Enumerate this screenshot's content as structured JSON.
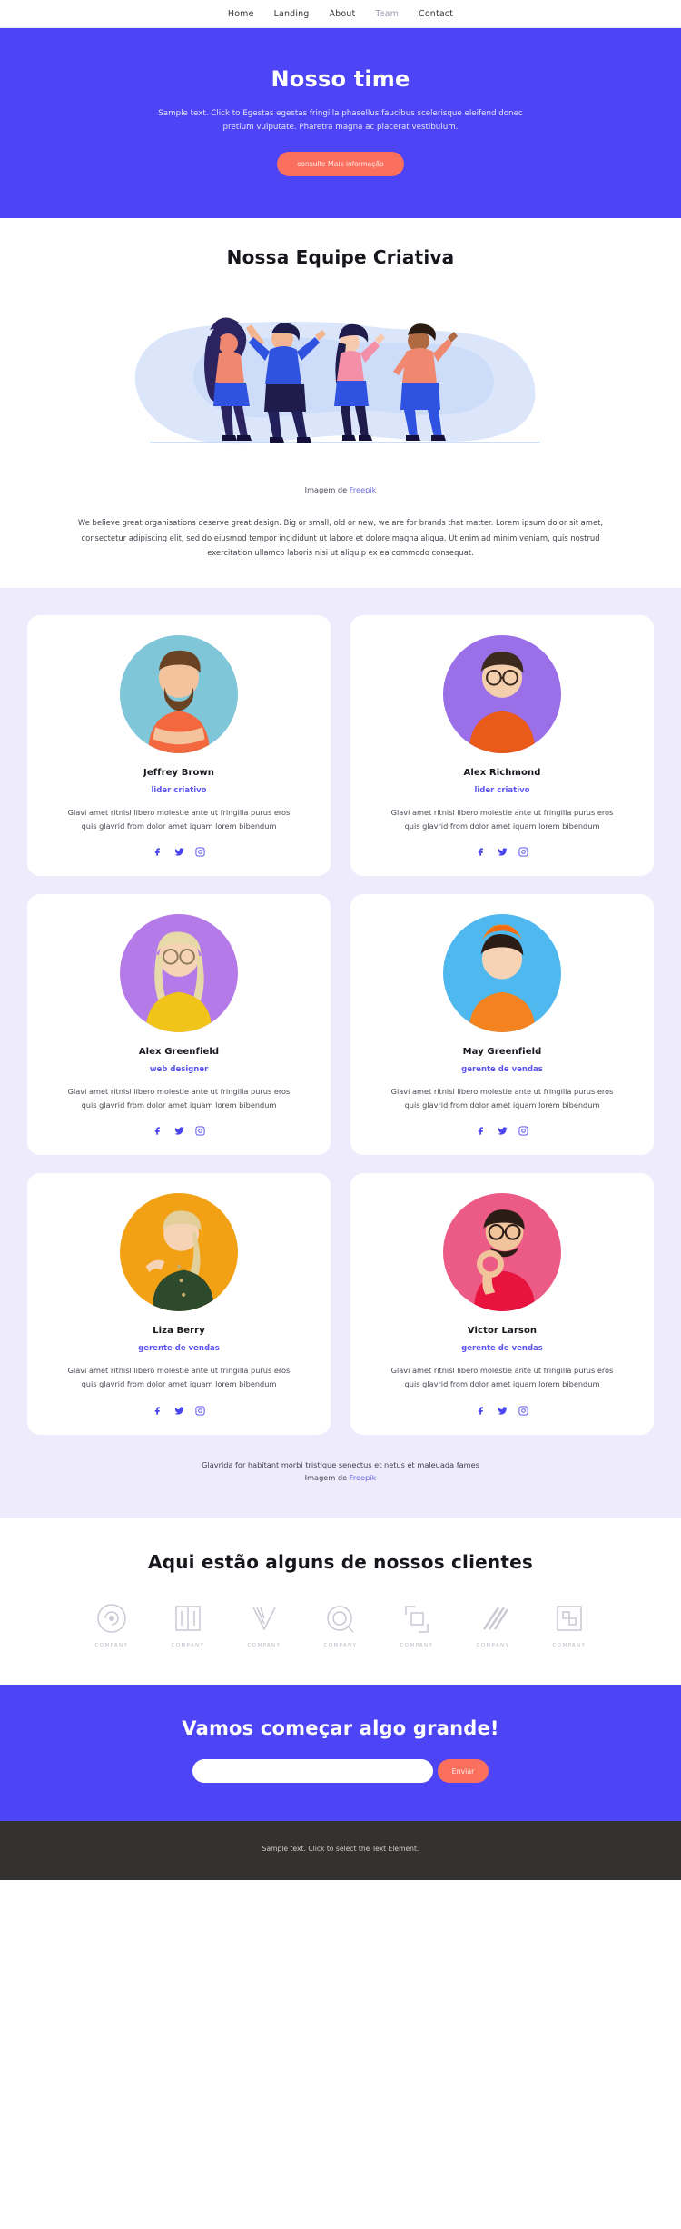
{
  "nav": {
    "items": [
      {
        "label": "Home",
        "active": false
      },
      {
        "label": "Landing",
        "active": false
      },
      {
        "label": "About",
        "active": false
      },
      {
        "label": "Team",
        "active": true
      },
      {
        "label": "Contact",
        "active": false
      }
    ]
  },
  "hero": {
    "title": "Nosso time",
    "paragraph": "Sample text. Click to Egestas egestas fringilla phasellus faucibus scelerisque eleifend donec pretium vulputate. Pharetra magna ac placerat vestibulum.",
    "button": "consulte Mais informação",
    "background": "#4d44f5",
    "button_color": "#fb6f5f"
  },
  "creative": {
    "heading": "Nossa Equipe Criativa",
    "credit_prefix": "Imagem de ",
    "credit_link": "Freepik",
    "lead": "We believe great organisations deserve great design. Big or small, old or new, we are for brands that matter. Lorem ipsum dolor sit amet, consectetur adipiscing elit, sed do eiusmod tempor incididunt ut labore et dolore magna aliqua. Ut enim ad minim veniam, quis nostrud exercitation ullamco laboris nisi ut aliquip ex ea commodo consequat."
  },
  "team": {
    "background": "#eeecfc",
    "description": "Glavi amet ritnisl libero molestie ante ut fringilla purus eros quis glavrid from dolor amet iquam lorem bibendum",
    "members": [
      {
        "name": "Jeffrey Brown",
        "role": "lider criativo",
        "bg": "#7fc6d9",
        "shirt": "#f4683f",
        "hair": "#6a4324",
        "skin": "#f2c39c",
        "glasses": false
      },
      {
        "name": "Alex Richmond",
        "role": "lider criativo",
        "bg": "#9a6fe8",
        "shirt": "#ea5a18",
        "hair": "#3b2a1d",
        "skin": "#f4cfae",
        "glasses": true
      },
      {
        "name": "Alex Greenfield",
        "role": "web designer",
        "bg": "#b47ae8",
        "shirt": "#f0c419",
        "hair": "#e8d9a8",
        "skin": "#f6d3b4",
        "glasses": true
      },
      {
        "name": "May Greenfield",
        "role": "gerente de vendas",
        "bg": "#4fb8ef",
        "shirt": "#f4831f",
        "hair": "#2b1d16",
        "skin": "#f6d3b4",
        "glasses": false
      },
      {
        "name": "Liza Berry",
        "role": "gerente de vendas",
        "bg": "#f3a114",
        "shirt": "#2e4a2c",
        "hair": "#e3cf9a",
        "skin": "#f6d3b4",
        "glasses": false
      },
      {
        "name": "Victor Larson",
        "role": "gerente de vendas",
        "bg": "#ec5b86",
        "shirt": "#e8143f",
        "hair": "#2b1d16",
        "skin": "#f1c39a",
        "glasses": true
      }
    ],
    "socials": [
      "facebook-icon",
      "twitter-icon",
      "instagram-icon"
    ],
    "social_color": "#4b45ef",
    "footer_line": "Glavrida for habitant morbi tristique senectus et netus et maleuada fames",
    "footer_credit_prefix": "Imagem de ",
    "footer_credit_link": "Freepik"
  },
  "clients": {
    "heading": "Aqui estão alguns de nossos clientes",
    "logos": [
      {
        "caption": "COMPANY",
        "icon": "logo-circle-swirl"
      },
      {
        "caption": "COMPANY",
        "icon": "logo-open-book"
      },
      {
        "caption": "COMPANY",
        "icon": "logo-wave-lines"
      },
      {
        "caption": "COMPANY",
        "icon": "logo-circle-ring"
      },
      {
        "caption": "COMPANY",
        "icon": "logo-corner-brackets"
      },
      {
        "caption": "COMPANY",
        "icon": "logo-diagonal-stripes"
      },
      {
        "caption": "COMPANY",
        "icon": "logo-nested-squares"
      }
    ]
  },
  "cta": {
    "heading": "Vamos começar algo grande!",
    "input_value": "",
    "input_placeholder": "",
    "button": "Enviar"
  },
  "footer": {
    "text": "Sample text. Click to select the Text Element."
  }
}
